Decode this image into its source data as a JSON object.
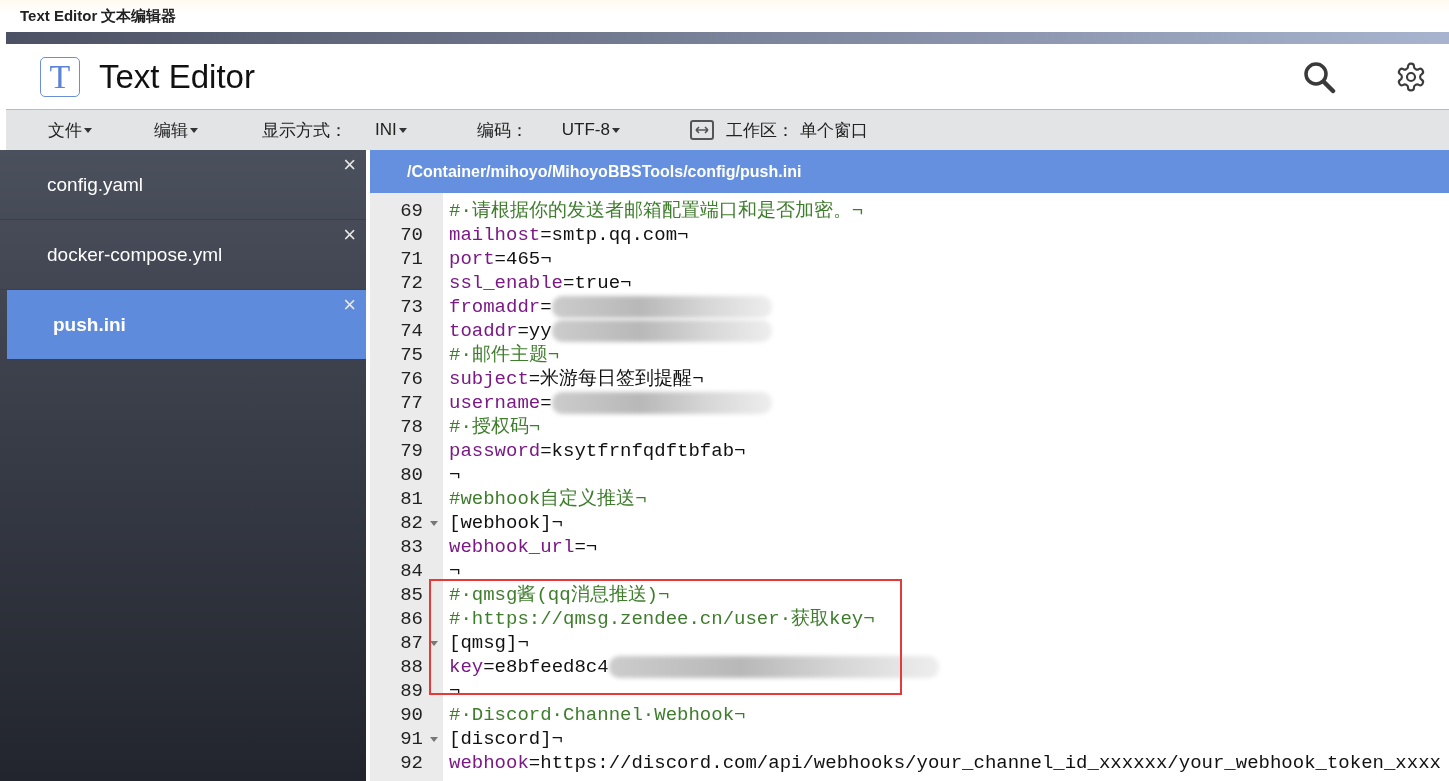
{
  "window": {
    "title": "Text Editor 文本编辑器"
  },
  "app": {
    "title": "Text Editor",
    "logo_letter": "T"
  },
  "menu": [
    {
      "kind": "dropdown",
      "label": "文件"
    },
    {
      "kind": "dropdown",
      "label": "编辑"
    },
    {
      "kind": "label",
      "label": "显示方式："
    },
    {
      "kind": "dropdown",
      "label": "INI"
    },
    {
      "kind": "label",
      "label": "编码："
    },
    {
      "kind": "dropdown",
      "label": "UTF-8"
    },
    {
      "kind": "workspace",
      "label": "工作区："
    },
    {
      "kind": "label",
      "label": "单个窗口"
    }
  ],
  "files": [
    {
      "name": "config.yaml",
      "selected": false,
      "close": "×"
    },
    {
      "name": "docker-compose.yml",
      "selected": false,
      "close": "×"
    },
    {
      "name": "push.ini",
      "selected": true,
      "close": "×"
    }
  ],
  "editor": {
    "path": "/Container/mihoyo/MihoyoBBSTools/config/push.ini",
    "lines": [
      {
        "number": "69",
        "kind": "comment",
        "text": "#·请根据你的发送者邮箱配置端口和是否加密。¬"
      },
      {
        "number": "70",
        "kind": "pair",
        "key": "mailhost",
        "value": "=smtp.qq.com¬"
      },
      {
        "number": "71",
        "kind": "pair",
        "key": "port",
        "value": "=465¬"
      },
      {
        "number": "72",
        "kind": "pair",
        "key": "ssl_enable",
        "value": "=true¬"
      },
      {
        "number": "73",
        "kind": "pair",
        "key": "fromaddr",
        "value": "=",
        "redacted": true
      },
      {
        "number": "74",
        "kind": "pair",
        "key": "toaddr",
        "value": "=yy",
        "redacted": true
      },
      {
        "number": "75",
        "kind": "comment",
        "text": "#·邮件主题¬"
      },
      {
        "number": "76",
        "kind": "pair",
        "key": "subject",
        "value": "=米游每日签到提醒¬"
      },
      {
        "number": "77",
        "kind": "pair",
        "key": "username",
        "value": "=",
        "redacted": true
      },
      {
        "number": "78",
        "kind": "comment",
        "text": "#·授权码¬"
      },
      {
        "number": "79",
        "kind": "pair",
        "key": "password",
        "value": "=ksytfrnfqdftbfab¬"
      },
      {
        "number": "80",
        "kind": "blank",
        "text": "¬"
      },
      {
        "number": "81",
        "kind": "comment",
        "text": "#webhook自定义推送¬"
      },
      {
        "number": "82",
        "kind": "section",
        "text": "[webhook]¬",
        "foldable": true
      },
      {
        "number": "83",
        "kind": "pair",
        "key": "webhook_url",
        "value": "=¬"
      },
      {
        "number": "84",
        "kind": "blank",
        "text": "¬"
      },
      {
        "number": "85",
        "kind": "comment",
        "text": "#·qmsg酱(qq消息推送)¬",
        "highlighted": true
      },
      {
        "number": "86",
        "kind": "comment",
        "text": "#·https://qmsg.zendee.cn/user·获取key¬",
        "highlighted": true
      },
      {
        "number": "87",
        "kind": "section",
        "text": "[qmsg]¬",
        "foldable": true,
        "highlighted": true
      },
      {
        "number": "88",
        "kind": "pair",
        "key": "key",
        "value": "=e8bfeed8c4",
        "redacted": true,
        "highlighted": true
      },
      {
        "number": "89",
        "kind": "blank",
        "text": "¬"
      },
      {
        "number": "90",
        "kind": "comment",
        "text": "#·Discord·Channel·Webhook¬"
      },
      {
        "number": "91",
        "kind": "section",
        "text": "[discord]¬",
        "foldable": true
      },
      {
        "number": "92",
        "kind": "pair",
        "key": "webhook",
        "value": "=https://discord.com/api/webhooks/your_channel_id_xxxxxx/your_webhook_token_xxxx"
      }
    ]
  }
}
